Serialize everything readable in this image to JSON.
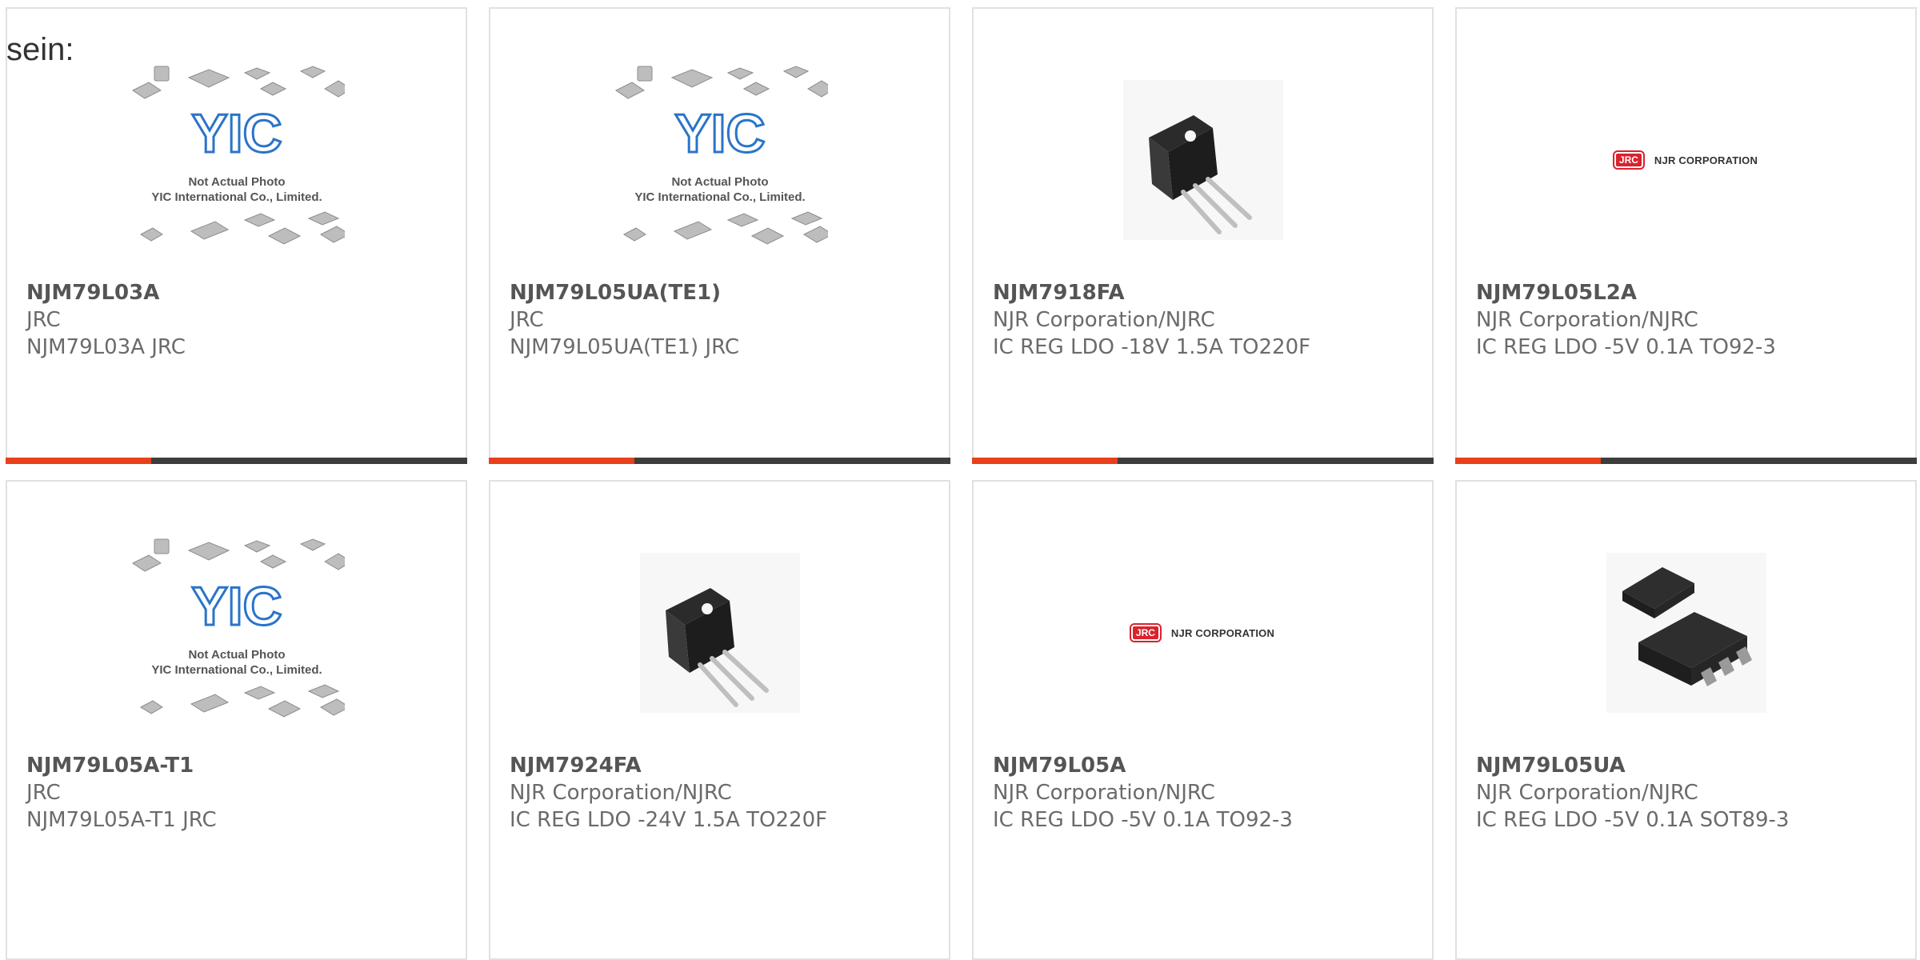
{
  "intro_text": "sein:",
  "placeholder_watermark": {
    "brand": "YIC",
    "line1": "Not Actual Photo",
    "line2": "YIC International Co., Limited."
  },
  "njr_logo": {
    "badge": "JRC",
    "text": "NJR CORPORATION"
  },
  "products": [
    {
      "part_number": "NJM79L03A",
      "manufacturer": "JRC",
      "description": "NJM79L03A JRC",
      "image": "placeholder"
    },
    {
      "part_number": "NJM79L05UA(TE1)",
      "manufacturer": "JRC",
      "description": "NJM79L05UA(TE1) JRC",
      "image": "placeholder"
    },
    {
      "part_number": "NJM7918FA",
      "manufacturer": "NJR Corporation/NJRC",
      "description": "IC REG LDO -18V 1.5A TO220F",
      "image": "to220f-package"
    },
    {
      "part_number": "NJM79L05L2A",
      "manufacturer": "NJR Corporation/NJRC",
      "description": "IC REG LDO -5V 0.1A TO92-3",
      "image": "njr-logo"
    },
    {
      "part_number": "NJM79L05A-T1",
      "manufacturer": "JRC",
      "description": "NJM79L05A-T1 JRC",
      "image": "placeholder"
    },
    {
      "part_number": "NJM7924FA",
      "manufacturer": "NJR Corporation/NJRC",
      "description": "IC REG LDO -24V 1.5A TO220F",
      "image": "to220f-package"
    },
    {
      "part_number": "NJM79L05A",
      "manufacturer": "NJR Corporation/NJRC",
      "description": "IC REG LDO -5V 0.1A TO92-3",
      "image": "njr-logo"
    },
    {
      "part_number": "NJM79L05UA",
      "manufacturer": "NJR Corporation/NJRC",
      "description": "IC REG LDO -5V 0.1A SOT89-3",
      "image": "sot89-package"
    }
  ],
  "colors": {
    "accent": "#e8401c",
    "bar_dark": "#3d3d3d",
    "card_border": "#e1e1e1",
    "text": "#5a5a5a",
    "yic_blue": "#2a74c9"
  }
}
